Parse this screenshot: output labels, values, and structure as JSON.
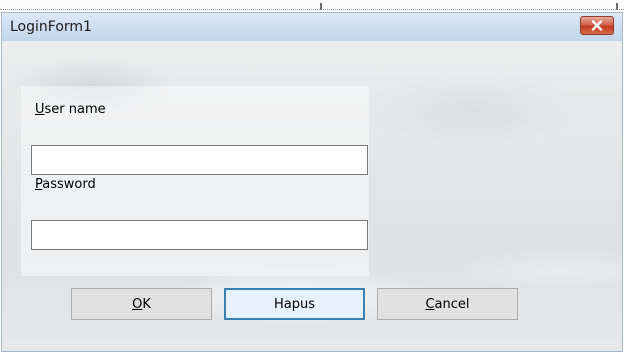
{
  "window": {
    "title": "LoginForm1",
    "close_icon": "close-icon"
  },
  "form": {
    "username": {
      "label_mnemonic": "U",
      "label_rest": "ser name",
      "value": ""
    },
    "password": {
      "label_mnemonic": "P",
      "label_rest": "assword",
      "value": ""
    }
  },
  "buttons": {
    "ok": {
      "mnemonic": "O",
      "rest": "K"
    },
    "hapus": {
      "label": "Hapus"
    },
    "cancel": {
      "mnemonic": "C",
      "rest": "ancel"
    }
  },
  "colors": {
    "close_button": "#c23a21",
    "default_button_border": "#3c7fb1",
    "titlebar": "#cfdff0"
  }
}
